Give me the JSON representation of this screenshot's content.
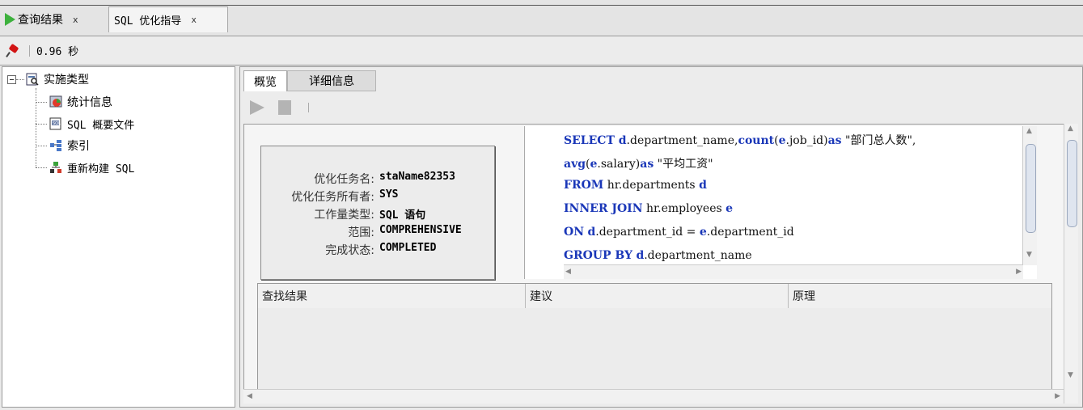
{
  "tabs": [
    {
      "label": "查询结果",
      "close": "x"
    },
    {
      "label": "SQL 优化指导",
      "close": "x"
    }
  ],
  "toolbar": {
    "time": "0.96 秒"
  },
  "tree": {
    "root": "实施类型",
    "children": [
      "统计信息",
      "SQL 概要文件",
      "索引",
      "重新构建 SQL"
    ]
  },
  "panel": {
    "tabs": [
      "概览",
      "详细信息"
    ],
    "summary": {
      "task_name_label": "优化任务名:",
      "task_name": "staName82353",
      "owner_label": "优化任务所有者:",
      "owner": "SYS",
      "workload_label": "工作量类型:",
      "workload": "SQL 语句",
      "scope_label": "范围:",
      "scope": "COMPREHENSIVE",
      "status_label": "完成状态:",
      "status": "COMPLETED"
    },
    "sql": [
      {
        "parts": [
          [
            "kw",
            "SELECT "
          ],
          [
            "kw",
            "d"
          ],
          [
            "",
            "."
          ],
          [
            "",
            "department_name,"
          ],
          [
            "kw",
            "count"
          ],
          [
            "",
            "("
          ],
          [
            "kw",
            "e"
          ],
          [
            "",
            ".job_id)"
          ],
          [
            "kw",
            "as"
          ],
          [
            "",
            " \"部门总人数\","
          ]
        ]
      },
      {
        "parts": [
          [
            "kw",
            "avg"
          ],
          [
            "",
            "("
          ],
          [
            "kw",
            "e"
          ],
          [
            "",
            ".salary)"
          ],
          [
            "kw",
            "as"
          ],
          [
            "",
            " \"平均工资\""
          ]
        ]
      },
      {
        "parts": [
          [
            "kw",
            "FROM"
          ],
          [
            "",
            " hr.departments "
          ],
          [
            "kw",
            "d"
          ]
        ]
      },
      {
        "parts": [
          [
            "kw",
            "INNER JOIN"
          ],
          [
            "",
            " hr.employees "
          ],
          [
            "kw",
            "e"
          ]
        ]
      },
      {
        "parts": [
          [
            "kw",
            "ON"
          ],
          [
            "",
            " "
          ],
          [
            "kw",
            "d"
          ],
          [
            "",
            ".department_id = "
          ],
          [
            "kw",
            "e"
          ],
          [
            "",
            ".department_id"
          ]
        ]
      },
      {
        "parts": [
          [
            "kw",
            "GROUP BY"
          ],
          [
            "",
            " "
          ],
          [
            "kw",
            "d"
          ],
          [
            "",
            ".department_name"
          ]
        ]
      }
    ],
    "table_headers": [
      "查找结果",
      "建议",
      "原理"
    ]
  },
  "colors": {
    "keyword": "#1a37b8",
    "run_icon": "#3db13d",
    "pin_icon": "#d21414"
  }
}
